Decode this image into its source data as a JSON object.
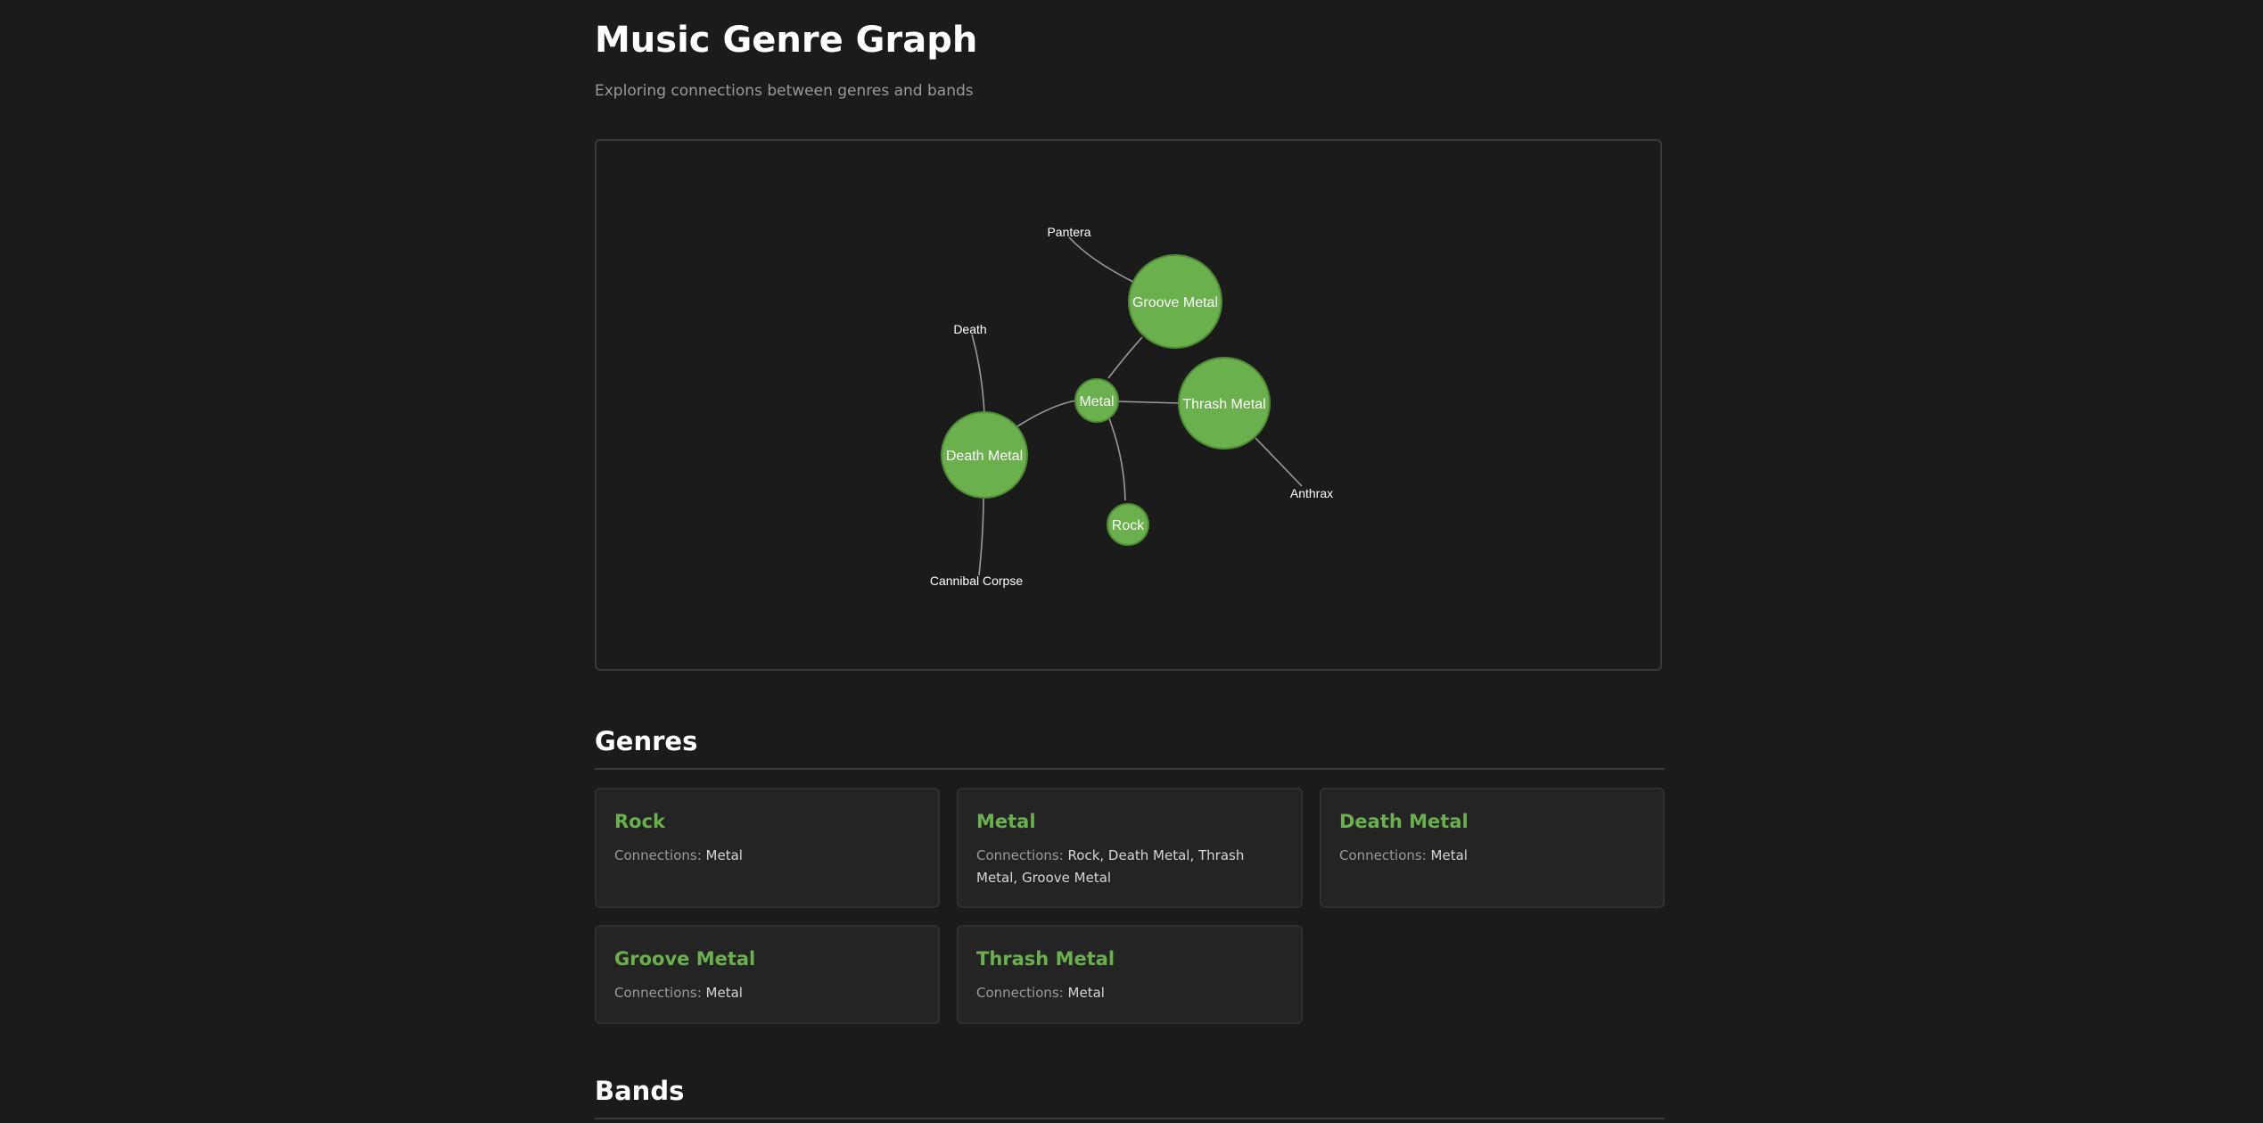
{
  "header": {
    "title": "Music Genre Graph",
    "subtitle": "Exploring connections between genres and bands"
  },
  "graph": {
    "node_color": "#6ab04c",
    "link_color": "#9a9a9a",
    "genre_nodes": [
      {
        "id": "groove",
        "label": "Groove Metal"
      },
      {
        "id": "metal",
        "label": "Metal"
      },
      {
        "id": "thrash",
        "label": "Thrash Metal"
      },
      {
        "id": "death",
        "label": "Death Metal"
      },
      {
        "id": "rock",
        "label": "Rock"
      }
    ],
    "band_labels": [
      {
        "id": "pantera",
        "label": "Pantera"
      },
      {
        "id": "death_band",
        "label": "Death"
      },
      {
        "id": "anthrax",
        "label": "Anthrax"
      },
      {
        "id": "cannibal",
        "label": "Cannibal Corpse"
      }
    ]
  },
  "genres_section": {
    "title": "Genres",
    "connections_label": "Connections:",
    "cards": [
      {
        "name": "Rock",
        "connections": "Metal"
      },
      {
        "name": "Metal",
        "connections": "Rock, Death Metal, Thrash Metal, Groove Metal"
      },
      {
        "name": "Death Metal",
        "connections": "Metal"
      },
      {
        "name": "Groove Metal",
        "connections": "Metal"
      },
      {
        "name": "Thrash Metal",
        "connections": "Metal"
      }
    ]
  },
  "bands_section": {
    "title": "Bands"
  }
}
